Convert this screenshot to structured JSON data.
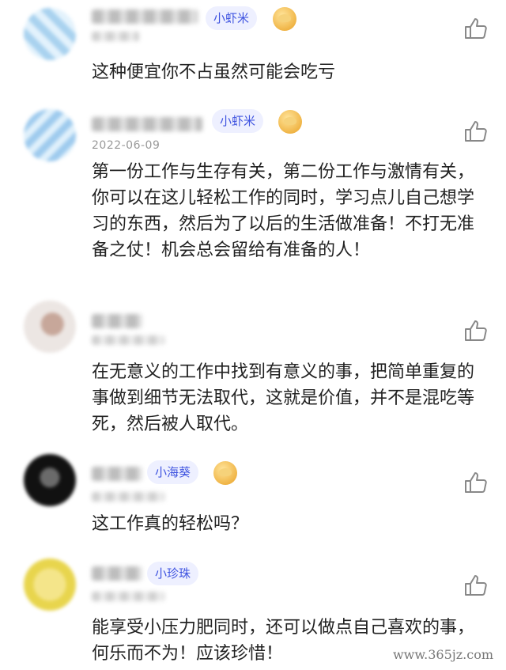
{
  "comments": [
    {
      "badge": "小虾米",
      "date": "",
      "text": "这种便宜你不占虽然可能会吃亏"
    },
    {
      "badge": "小虾米",
      "date": "2022-06-09",
      "text": "第一份工作与生存有关，第二份工作与激情有关，你可以在这儿轻松工作的同时，学习点儿自己想学习的东西，然后为了以后的生活做准备！不打无准备之仗！机会总会留给有准备的人！"
    },
    {
      "badge": "",
      "date": "",
      "text": "在无意义的工作中找到有意义的事，把简单重复的事做到细节无法取代，这就是价值，并不是混吃等死，然后被人取代。"
    },
    {
      "badge": "小海葵",
      "date": "",
      "text": "这工作真的轻松吗？"
    },
    {
      "badge": "小珍珠",
      "date": "",
      "text": "能享受小压力肥同时，还可以做点自己喜欢的事，何乐而不为！应该珍惜！"
    }
  ],
  "watermark": "www.365jz.com",
  "icons": {
    "like": "thumbs-up-icon",
    "medal": "medal-icon"
  },
  "colors": {
    "badge_text": "#3f54e0",
    "badge_bg": "#eef0ff",
    "date": "#999999"
  }
}
